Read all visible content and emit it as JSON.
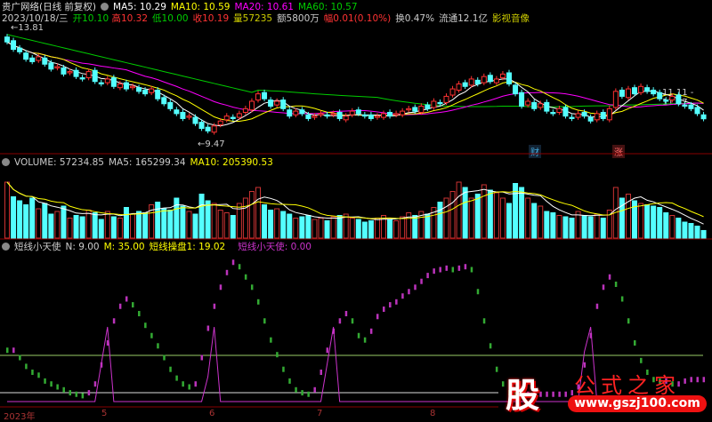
{
  "header": {
    "title": "贵广网络(日线 前复权)",
    "ma5": "MA5: 10.29",
    "ma10": "MA10: 10.59",
    "ma20": "MA20: 10.61",
    "ma60": "MA60: 10.57"
  },
  "quote": {
    "date": "2023/10/18/三",
    "open_l": "开",
    "open": "10.10",
    "high_l": "高",
    "high": "10.32",
    "low_l": "低",
    "low": "10.00",
    "close_l": "收",
    "close": "10.19",
    "vol_l": "量",
    "vol": "57235",
    "amt": "额5800万",
    "chg_l": "幅",
    "chg": "0.01(0.10%)",
    "turnover": "换0.47%",
    "float": "流通12.1亿",
    "media": "影视音像"
  },
  "price_labels": {
    "max": "13.81",
    "min": "9.47",
    "range": "11.11 - 11.07",
    "tag1": "财",
    "tag2": "涨"
  },
  "volume_header": {
    "label": "VOLUME: 57234.85",
    "ma5": "MA5: 165299.34",
    "ma10": "MA10: 205390.53"
  },
  "indicator_header": {
    "name": "短线小天使",
    "n": "N: 9.00",
    "m": "M: 35.00",
    "op": "短线操盘1: 19.02",
    "angel": "短线小天使: 0.00"
  },
  "xaxis": [
    "2023年",
    "5",
    "6",
    "7",
    "8"
  ],
  "watermark": {
    "text": "公式之家",
    "url": "www.gszj100.com",
    "glyph": "股"
  },
  "colors": {
    "up": "#ff3232",
    "down": "#54ffff",
    "ma5": "#ffffff",
    "ma10": "#ffff00",
    "ma20": "#ff00ff",
    "ma60": "#00cc00"
  },
  "chart_data": {
    "type": "candlestick",
    "close": [
      13.3,
      13.0,
      12.9,
      12.6,
      12.5,
      12.7,
      12.4,
      12.2,
      12.3,
      12.0,
      12.1,
      11.9,
      11.8,
      12.1,
      11.7,
      11.6,
      11.8,
      11.5,
      11.6,
      11.4,
      11.5,
      11.3,
      11.2,
      11.4,
      11.0,
      10.8,
      10.6,
      10.4,
      10.2,
      10.3,
      10.0,
      9.8,
      9.7,
      9.9,
      10.1,
      10.3,
      10.2,
      10.4,
      10.6,
      10.9,
      11.2,
      11.0,
      10.7,
      10.9,
      10.6,
      10.3,
      10.5,
      10.4,
      10.2,
      10.3,
      10.4,
      10.3,
      10.4,
      10.2,
      10.3,
      10.5,
      10.4,
      10.3,
      10.2,
      10.3,
      10.4,
      10.3,
      10.4,
      10.5,
      10.6,
      10.5,
      10.7,
      10.6,
      10.9,
      10.8,
      11.1,
      11.4,
      11.6,
      11.5,
      11.8,
      11.6,
      11.9,
      11.7,
      11.8,
      12.0,
      11.6,
      11.2,
      10.7,
      10.9,
      10.6,
      10.8,
      10.5,
      10.4,
      10.6,
      10.3,
      10.2,
      10.4,
      10.3,
      10.1,
      10.4,
      10.2,
      10.6,
      11.3,
      11.1,
      11.4,
      11.2,
      11.5,
      11.3,
      11.2,
      11.0,
      10.9,
      11.1,
      10.8,
      10.7,
      10.6,
      10.4,
      10.19
    ],
    "volume": [
      420,
      310,
      280,
      250,
      300,
      220,
      260,
      180,
      200,
      240,
      150,
      170,
      160,
      210,
      190,
      140,
      200,
      160,
      150,
      230,
      180,
      200,
      190,
      250,
      270,
      220,
      210,
      300,
      240,
      200,
      180,
      330,
      280,
      260,
      210,
      190,
      170,
      260,
      300,
      350,
      380,
      250,
      210,
      220,
      200,
      180,
      150,
      160,
      170,
      140,
      150,
      130,
      160,
      170,
      180,
      150,
      140,
      120,
      130,
      150,
      170,
      140,
      130,
      160,
      190,
      170,
      200,
      180,
      230,
      270,
      300,
      350,
      420,
      380,
      300,
      330,
      400,
      360,
      340,
      300,
      260,
      410,
      380,
      300,
      260,
      240,
      200,
      190,
      170,
      160,
      150,
      200,
      170,
      160,
      180,
      150,
      210,
      380,
      300,
      330,
      280,
      260,
      250,
      240,
      230,
      190,
      170,
      150,
      120,
      110,
      90,
      57
    ],
    "angel": [
      35,
      35,
      30,
      24,
      20,
      18,
      14,
      12,
      10,
      8,
      6,
      5,
      4,
      6,
      12,
      25,
      40,
      55,
      65,
      70,
      66,
      60,
      52,
      45,
      38,
      30,
      22,
      16,
      12,
      10,
      12,
      30,
      50,
      65,
      78,
      88,
      95,
      92,
      85,
      78,
      68,
      55,
      42,
      32,
      22,
      14,
      8,
      6,
      5,
      8,
      20,
      35,
      48,
      55,
      60,
      55,
      45,
      42,
      48,
      58,
      63,
      66,
      68,
      72,
      75,
      78,
      82,
      86,
      89,
      90,
      91,
      90,
      91,
      92,
      90,
      75,
      55,
      38,
      22,
      12,
      6,
      5,
      5,
      5,
      5,
      5,
      5,
      5,
      5,
      5,
      6,
      10,
      25,
      45,
      65,
      78,
      85,
      80,
      70,
      55,
      40,
      28,
      20,
      15,
      14,
      14,
      12,
      12,
      14,
      15,
      15,
      15
    ],
    "spike": [
      0,
      0,
      0,
      0,
      0,
      0,
      0,
      0,
      0,
      0,
      0,
      0,
      0,
      0,
      0,
      0.3,
      0.6,
      0,
      0,
      0,
      0,
      0,
      0,
      0,
      0,
      0,
      0,
      0,
      0,
      0,
      0,
      0,
      0.2,
      0.6,
      0,
      0,
      0,
      0,
      0,
      0,
      0,
      0,
      0,
      0,
      0,
      0,
      0,
      0,
      0,
      0,
      0,
      0.3,
      0.6,
      0,
      0,
      0,
      0,
      0,
      0,
      0,
      0,
      0,
      0,
      0,
      0,
      0,
      0,
      0,
      0,
      0,
      0,
      0,
      0,
      0,
      0,
      0,
      0,
      0,
      0,
      0,
      0,
      0,
      0,
      0,
      0,
      0,
      0,
      0,
      0,
      0,
      0,
      0,
      0.4,
      0.6,
      0,
      0,
      0,
      0,
      0,
      0,
      0,
      0,
      0,
      0,
      0,
      0,
      0,
      0,
      0,
      0,
      0,
      0
    ]
  }
}
